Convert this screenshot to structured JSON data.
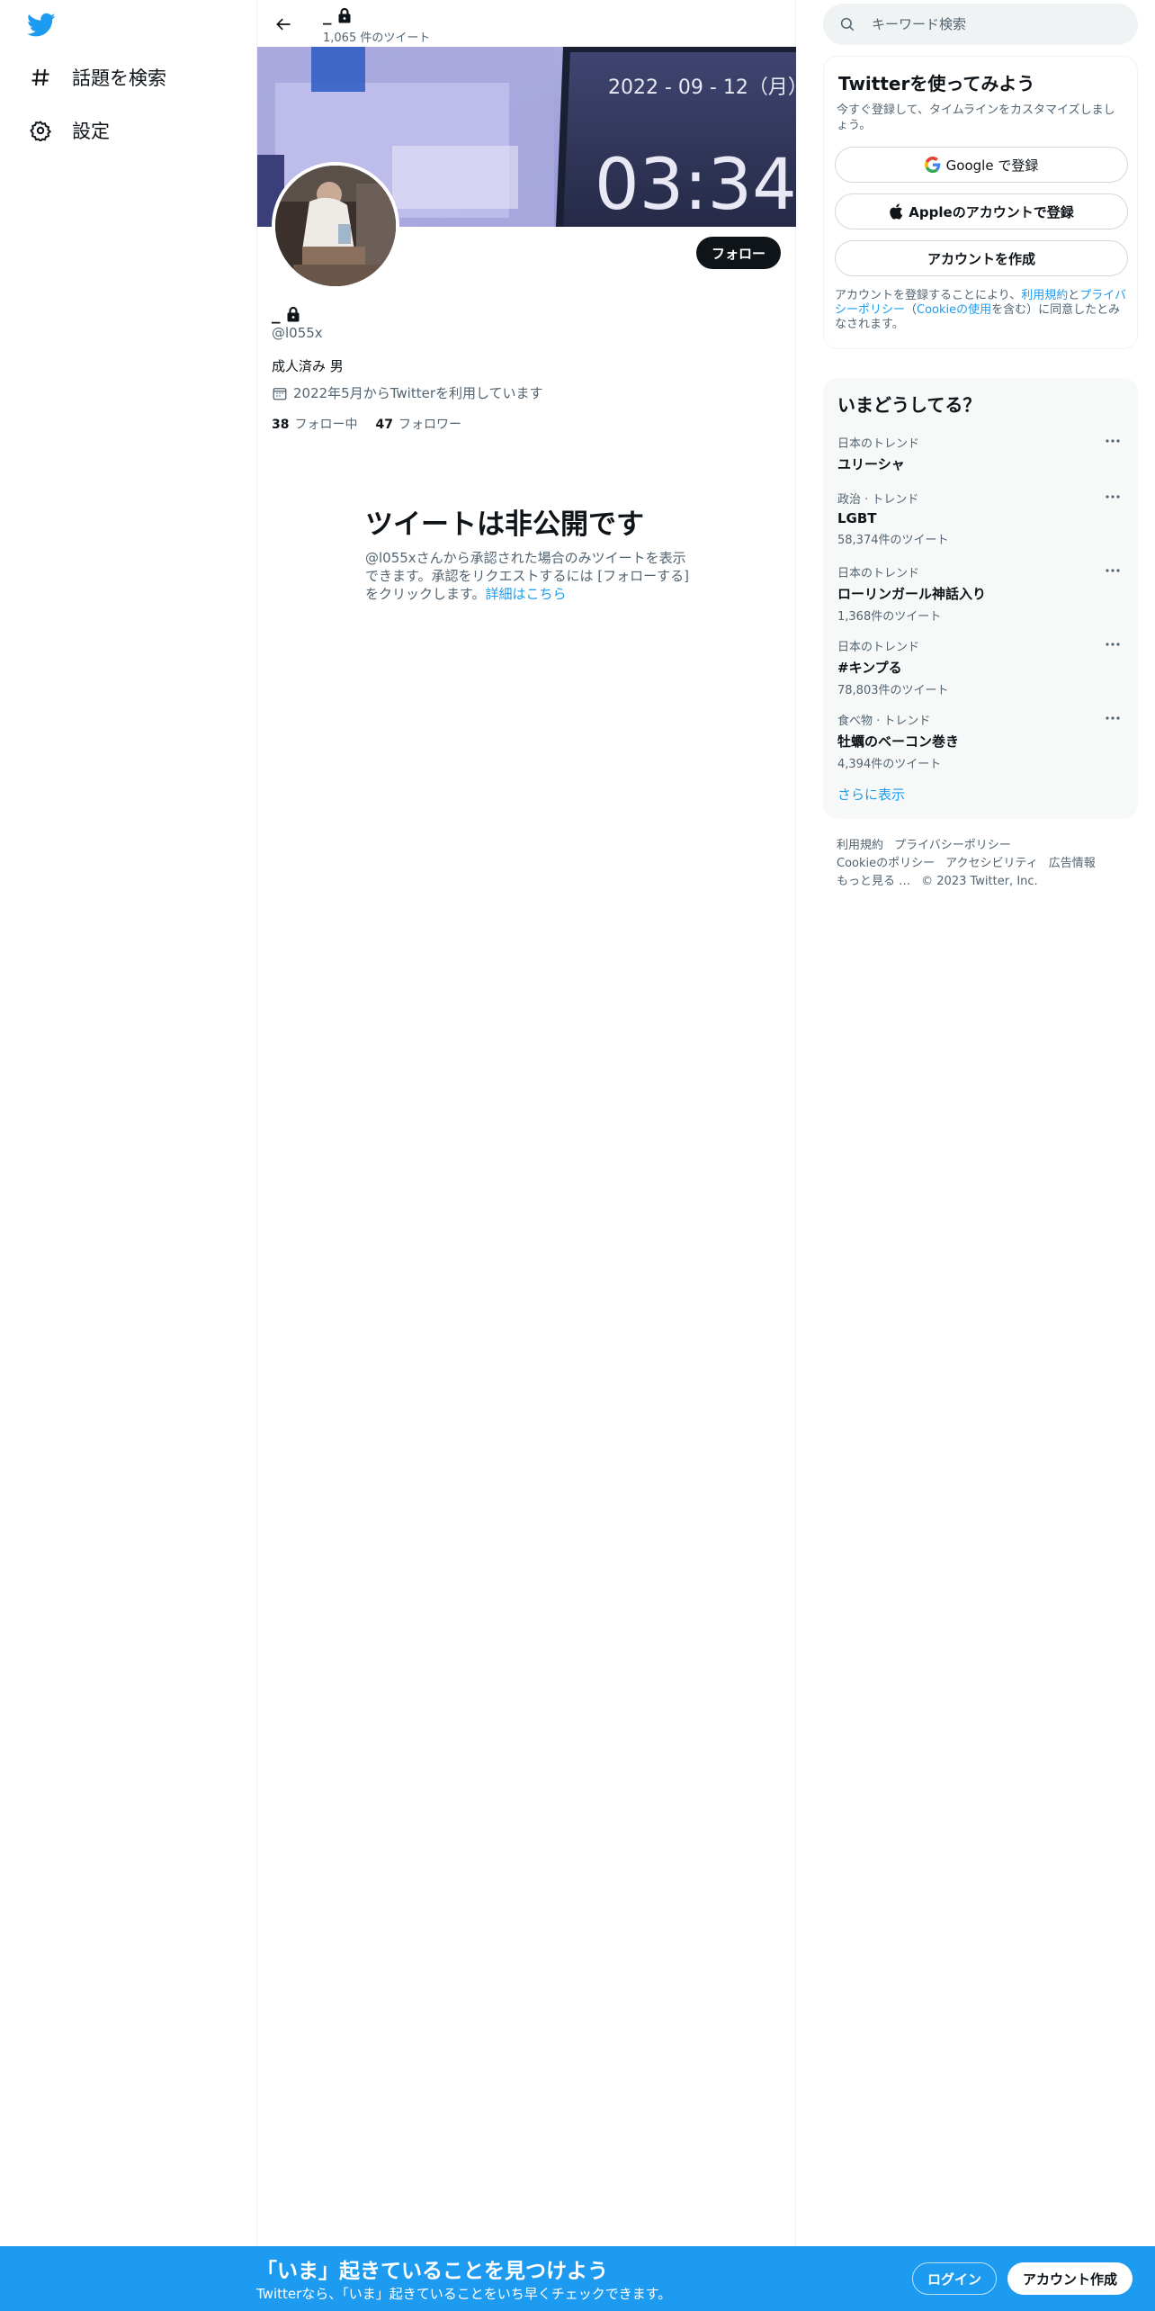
{
  "sidebar": {
    "logo_icon": "twitter-bird-icon",
    "items": [
      {
        "label": "話題を検索",
        "icon": "hashtag-icon"
      },
      {
        "label": "設定",
        "icon": "gear-icon"
      }
    ]
  },
  "header": {
    "name": "_",
    "tweet_count": "1,065 件のツイート"
  },
  "banner": {
    "date_text": "2022 - 09 - 12（月）",
    "time_text": "03:34"
  },
  "profile": {
    "name": "_",
    "handle": "@l055x",
    "bio": "成人済み 男",
    "joined": "2022年5月からTwitterを利用しています",
    "following_count": "38",
    "following_label": "フォロー中",
    "followers_count": "47",
    "followers_label": "フォロワー",
    "follow_button": "フォロー"
  },
  "private_notice": {
    "title": "ツイートは非公開です",
    "body": "@l055xさんから承認された場合のみツイートを表示できます。承認をリクエストするには [フォローする] をクリックします。",
    "link": "詳細はこちら"
  },
  "search": {
    "placeholder": "キーワード検索"
  },
  "signup": {
    "title": "Twitterを使ってみよう",
    "subtitle": "今すぐ登録して、タイムラインをカスタマイズしましょう。",
    "google_button": "Google で登録",
    "apple_button": "Appleのアカウントで登録",
    "create_button": "アカウントを作成",
    "legal_prefix": "アカウントを登録することにより、",
    "legal_terms": "利用規約",
    "legal_and": "と",
    "legal_privacy": "プライバシーポリシー",
    "legal_cookie_open": "（",
    "legal_cookie": "Cookieの使用",
    "legal_suffix": "を含む）に同意したとみなされます。"
  },
  "trends": {
    "title": "いまどうしてる？",
    "items": [
      {
        "category": "日本のトレンド",
        "name": "ユリーシャ",
        "count": ""
      },
      {
        "category": "政治 · トレンド",
        "name": "LGBT",
        "count": "58,374件のツイート"
      },
      {
        "category": "日本のトレンド",
        "name": "ローリンガール神話入り",
        "count": "1,368件のツイート"
      },
      {
        "category": "日本のトレンド",
        "name": "#キンプる",
        "count": "78,803件のツイート"
      },
      {
        "category": "食べ物 · トレンド",
        "name": "牡蠣のベーコン巻き",
        "count": "4,394件のツイート"
      }
    ],
    "show_more": "さらに表示"
  },
  "footer": {
    "links": [
      "利用規約",
      "プライバシーポリシー",
      "Cookieのポリシー",
      "アクセシビリティ",
      "広告情報",
      "もっと見る …"
    ],
    "copyright": "© 2023 Twitter, Inc."
  },
  "bottom_bar": {
    "title": "「いま」起きていることを見つけよう",
    "subtitle": "Twitterなら、「いま」起きていることをいち早くチェックできます。",
    "login_button": "ログイン",
    "signup_button": "アカウント作成"
  },
  "colors": {
    "accent": "#1d9bf0",
    "text_primary": "#0f1419",
    "text_secondary": "#536471"
  }
}
